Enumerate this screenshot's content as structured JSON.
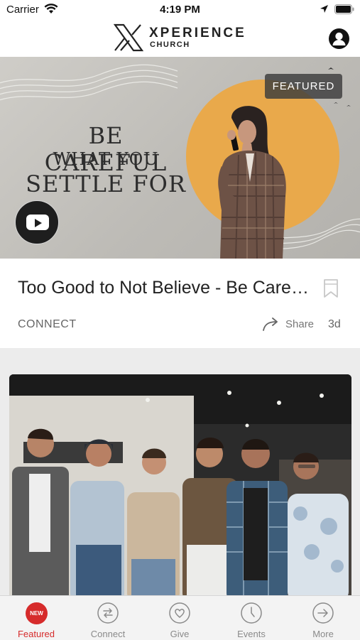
{
  "status_bar": {
    "carrier": "Carrier",
    "time": "4:19 PM"
  },
  "header": {
    "logo_line1": "XPERIENCE",
    "logo_line2": "CHURCH"
  },
  "featured_card": {
    "badge": "FEATURED",
    "artwork_lines": [
      "BE CAREFUL",
      "WHAT YOU",
      "SETTLE FOR"
    ],
    "title": "Too Good to Not Believe - Be Careful What You Settle For",
    "category": "CONNECT",
    "share_label": "Share",
    "age": "3d"
  },
  "tabs": [
    {
      "label": "Featured",
      "badge": "NEW",
      "icon": "new-badge-icon",
      "active": true
    },
    {
      "label": "Connect",
      "icon": "connect-arrows-icon",
      "active": false
    },
    {
      "label": "Give",
      "icon": "heart-icon",
      "active": false
    },
    {
      "label": "Events",
      "icon": "clock-icon",
      "active": false
    },
    {
      "label": "More",
      "icon": "arrow-right-circle-icon",
      "active": false
    }
  ],
  "colors": {
    "accent": "#d62b2b",
    "sun": "#e9a94b",
    "tab_inactive": "#8a8a8a"
  }
}
